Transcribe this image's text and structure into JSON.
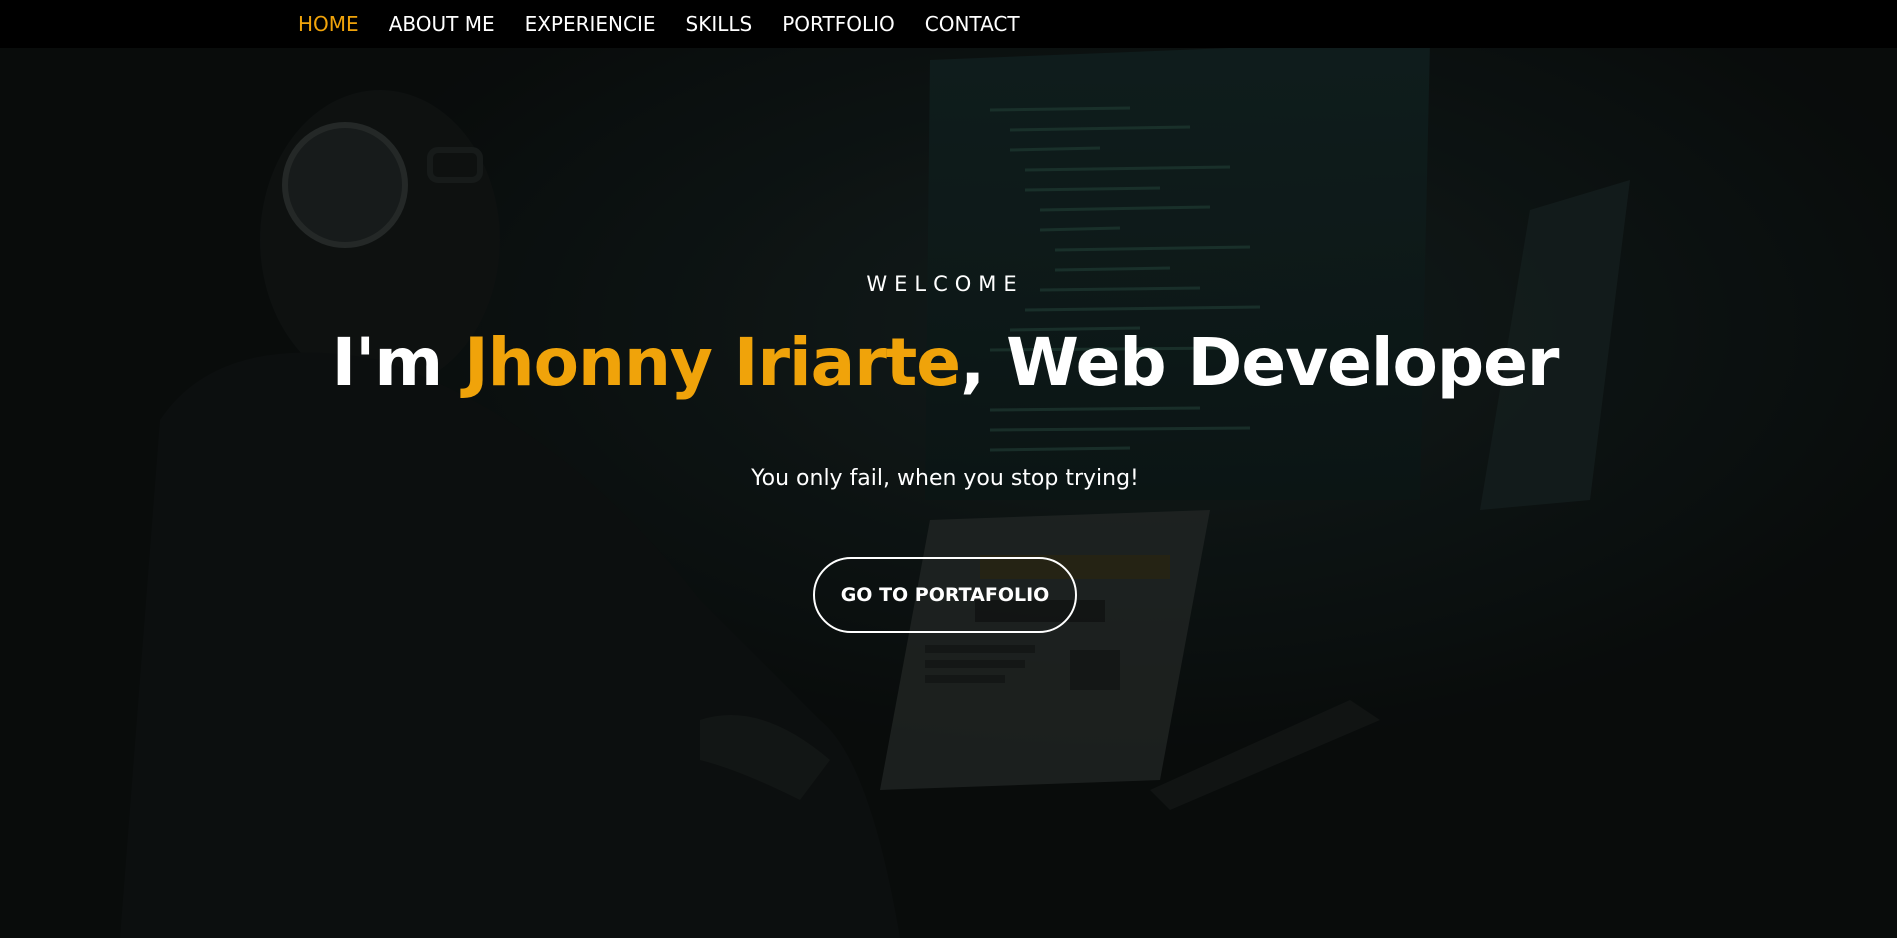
{
  "nav": {
    "items": [
      {
        "label": "HOME",
        "active": true
      },
      {
        "label": "ABOUT ME",
        "active": false
      },
      {
        "label": "EXPERIENCIE",
        "active": false
      },
      {
        "label": "SKILLS",
        "active": false
      },
      {
        "label": "PORTFOLIO",
        "active": false
      },
      {
        "label": "CONTACT",
        "active": false
      }
    ]
  },
  "hero": {
    "eyebrow": "WELCOME",
    "headline_prefix": "I'm ",
    "headline_name": "Jhonny Iriarte",
    "headline_suffix": ", Web Developer",
    "tagline": "You only fail, when you stop trying!",
    "cta_label": "GO TO PORTAFOLIO"
  },
  "colors": {
    "accent": "#f0a30a",
    "nav_background": "#000000",
    "text": "#ffffff"
  }
}
